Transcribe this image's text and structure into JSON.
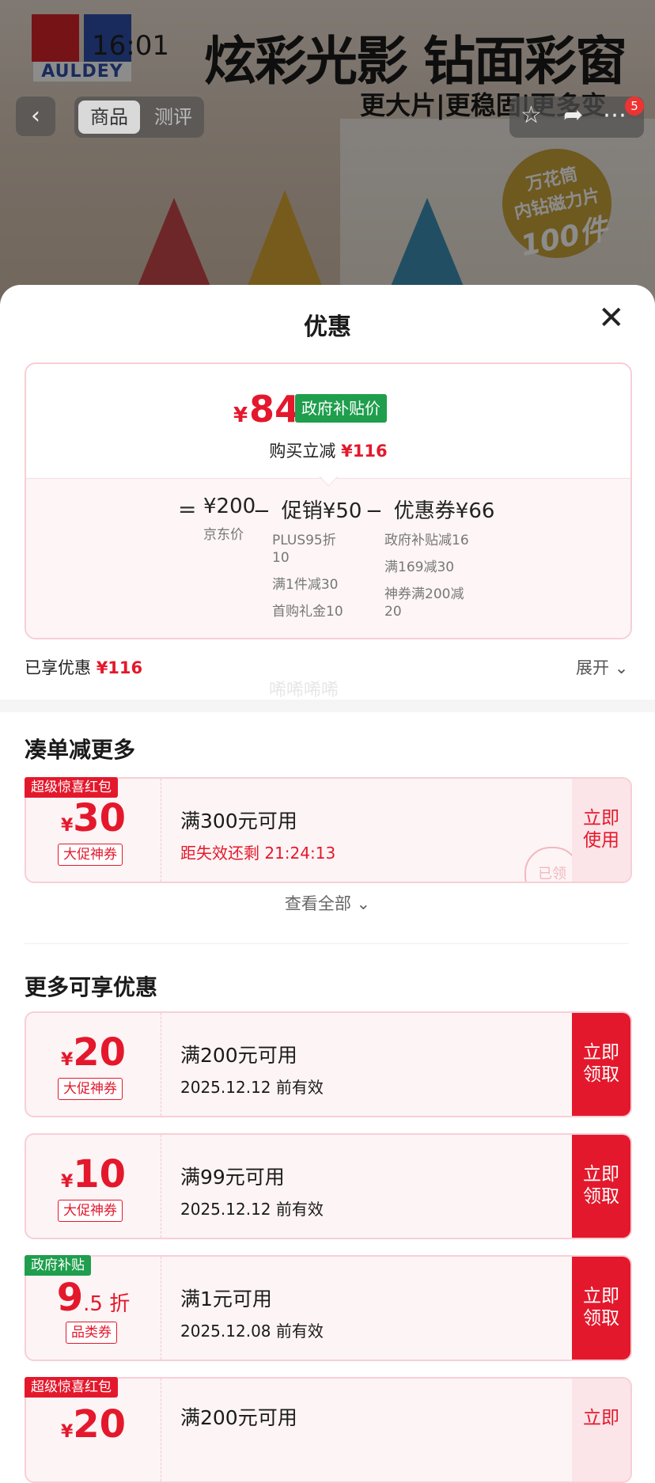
{
  "status": {
    "time": "16:01"
  },
  "background": {
    "brand": "AULDEY",
    "hero_title": "炫彩光影 钻面彩窗",
    "hero_sub": "更大片|更稳固|更多变",
    "sticker": [
      "万花筒",
      "内钻磁力片",
      "100件"
    ],
    "tabs": [
      "商品",
      "测评"
    ],
    "cart_badge": "5"
  },
  "sheet": {
    "title": "优惠",
    "close_label": "✕"
  },
  "price_card": {
    "currency": "¥",
    "final_price": "84",
    "tag": "政府补贴价",
    "reduce_label": "购买立减",
    "reduce_value": "¥116",
    "equals": "=",
    "jd": {
      "amount": "¥200",
      "label": "京东价"
    },
    "promo": {
      "op": "−",
      "amount": "促销¥50",
      "items": [
        "PLUS95折",
        "10",
        "满1件减30",
        "首购礼金10"
      ]
    },
    "coupon": {
      "op": "−",
      "amount": "优惠券¥66",
      "items": [
        "政府补贴减16",
        "满169减30",
        "神券满200减",
        "20"
      ]
    }
  },
  "enjoyed": {
    "label": "已享优惠",
    "value": "¥116",
    "expand": "展开",
    "watermark": "唏唏唏唏"
  },
  "section_combine": {
    "title": "凑单减更多",
    "coupons": [
      {
        "ribbon": "超级惊喜红包",
        "yen": "¥",
        "amount": "30",
        "kind": "大促神券",
        "condition": "满300元可用",
        "valid": "距失效还剩 21:24:13",
        "action": "立即使用",
        "stamp": "已领"
      }
    ],
    "view_all": "查看全部"
  },
  "section_more": {
    "title": "更多可享优惠",
    "coupons": [
      {
        "yen": "¥",
        "amount": "20",
        "kind": "大促神券",
        "condition": "满200元可用",
        "valid": "2025.12.12 前有效",
        "action": "立即领取"
      },
      {
        "yen": "¥",
        "amount": "10",
        "kind": "大促神券",
        "condition": "满99元可用",
        "valid": "2025.12.12 前有效",
        "action": "立即领取"
      },
      {
        "ribbon": "政府补贴",
        "amount": "9",
        "suffix": ".5 折",
        "kind": "品类券",
        "condition": "满1元可用",
        "valid": "2025.12.08 前有效",
        "action": "立即领取"
      },
      {
        "ribbon": "超级惊喜红包",
        "yen": "¥",
        "amount": "20",
        "condition": "满200元可用",
        "action": "立即"
      }
    ]
  },
  "colors": {
    "accent_red": "#e4182c",
    "gov_green": "#1f9e4d"
  }
}
